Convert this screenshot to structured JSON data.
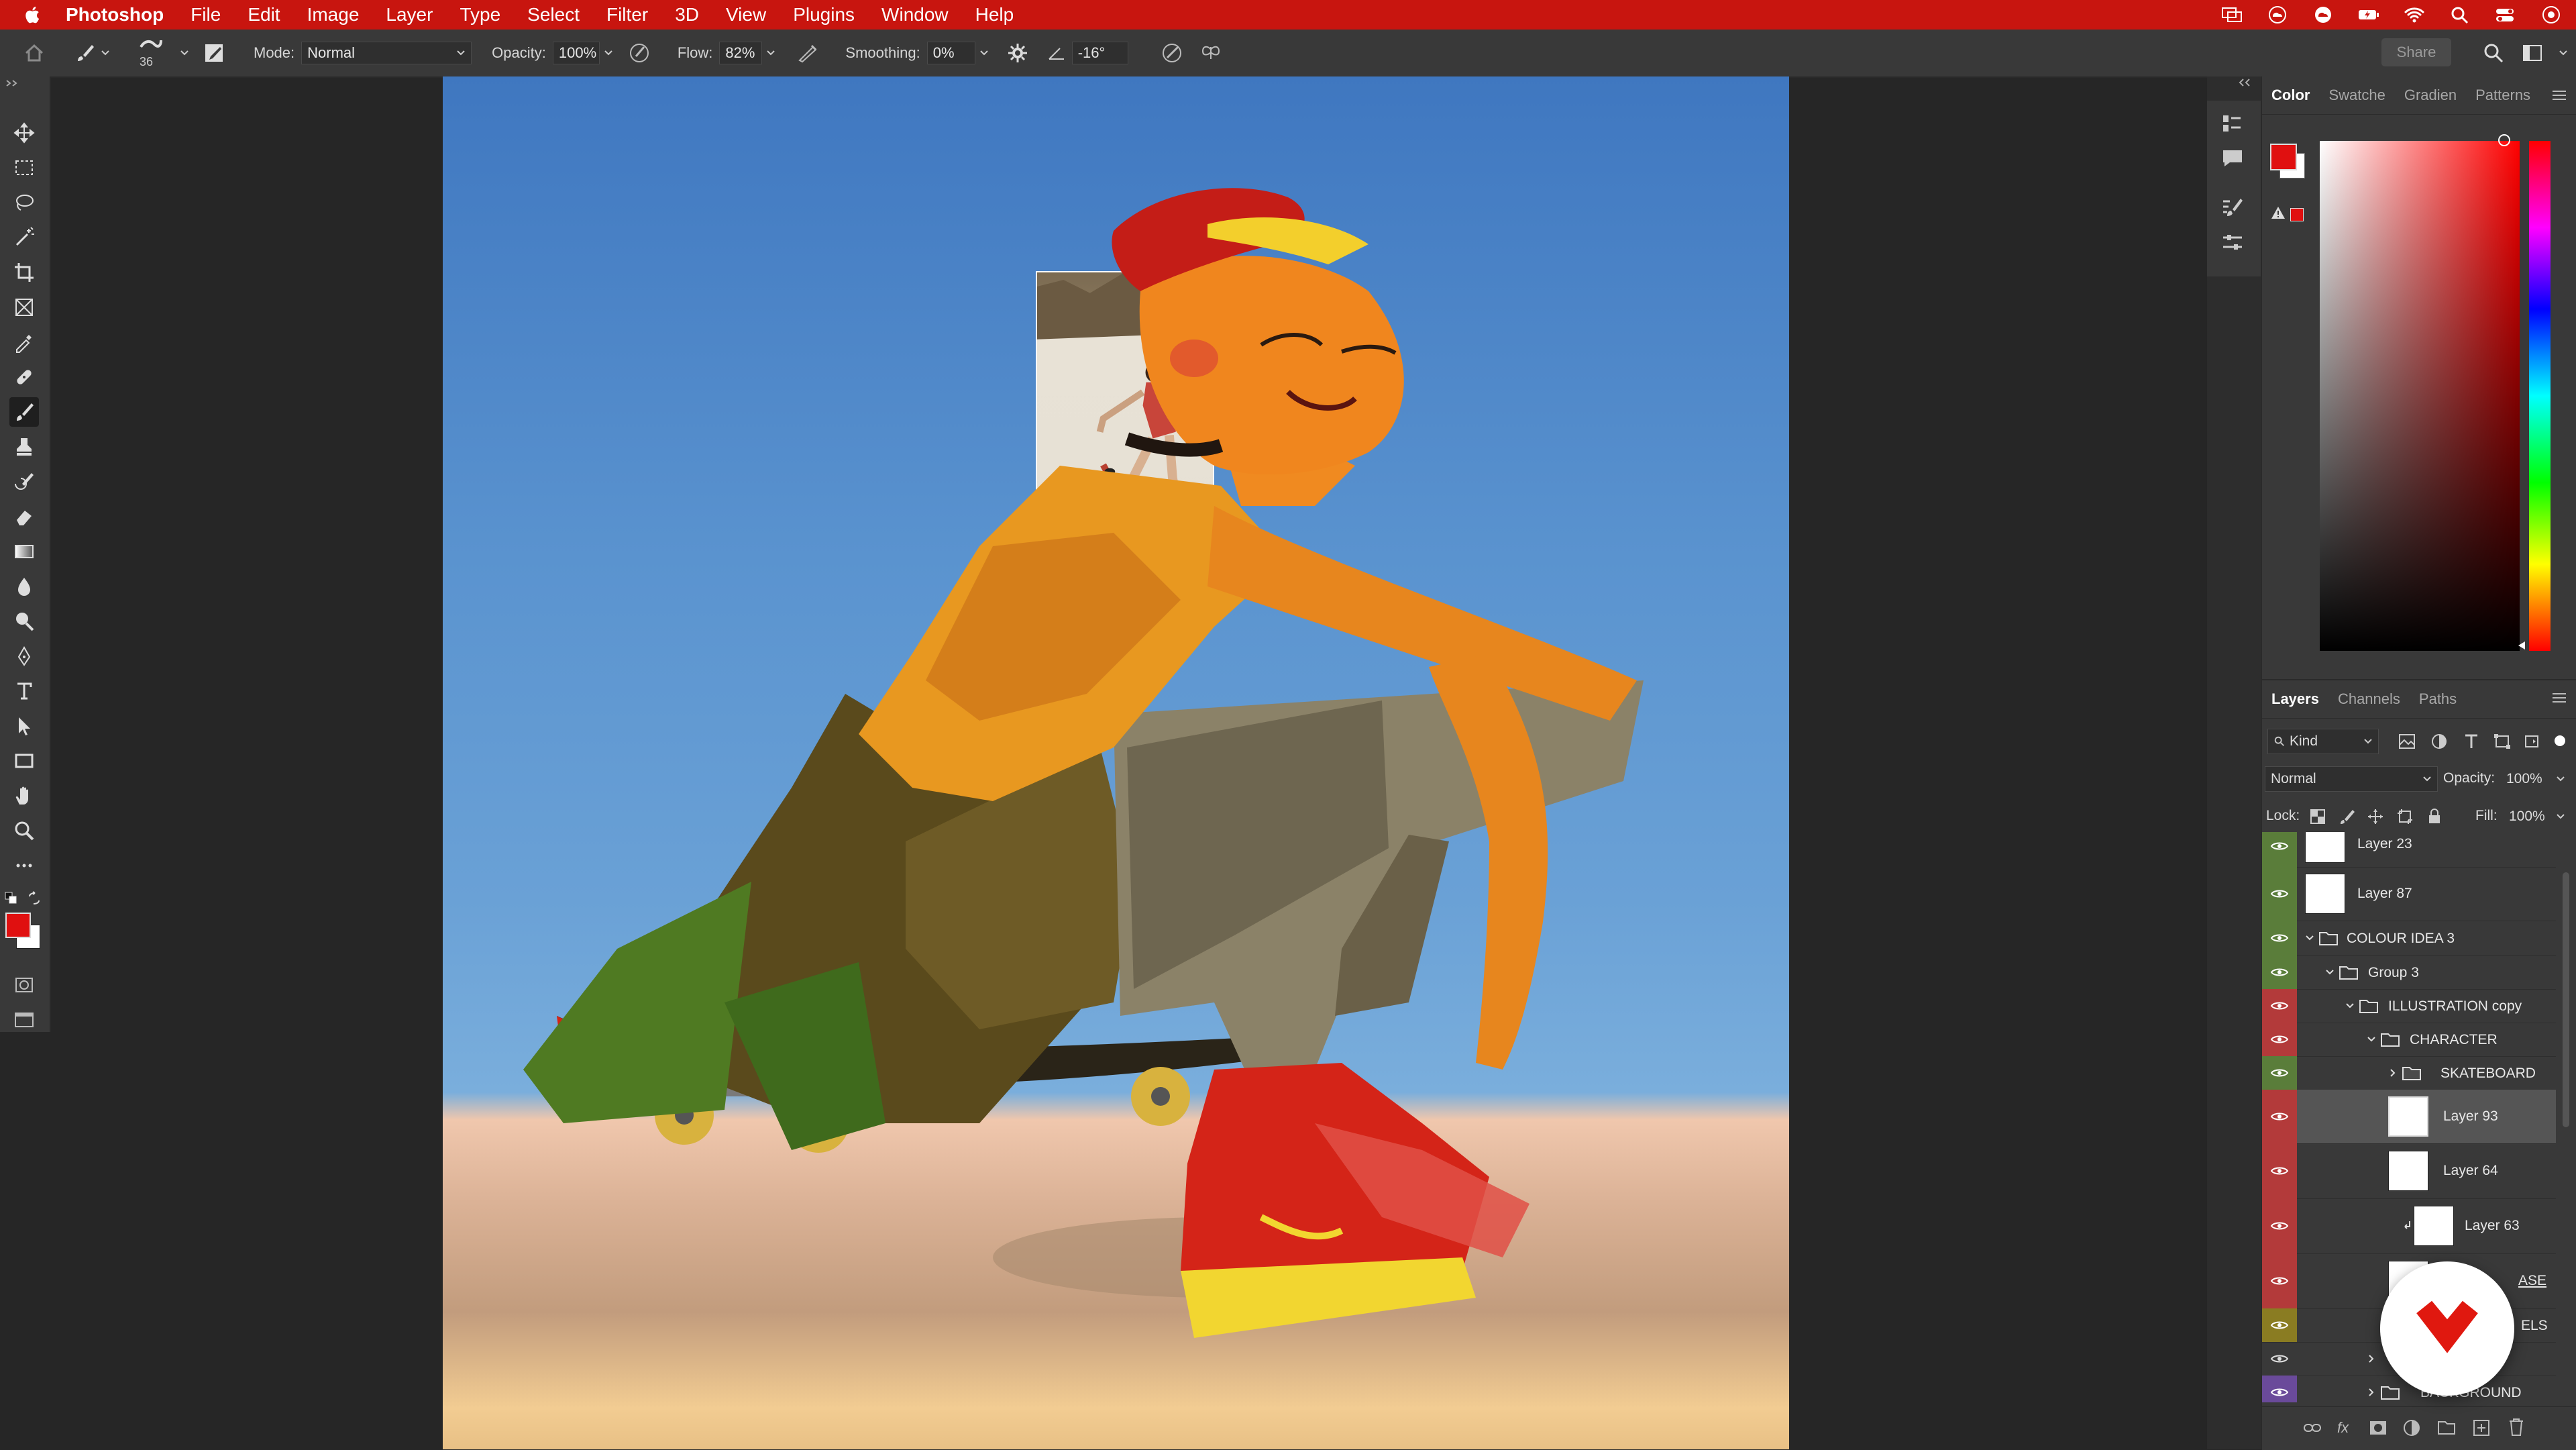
{
  "menubar": {
    "app_name": "Photoshop",
    "menus": [
      "File",
      "Edit",
      "Image",
      "Layer",
      "Type",
      "Select",
      "Filter",
      "3D",
      "View",
      "Plugins",
      "Window",
      "Help"
    ]
  },
  "options_bar": {
    "brush_size": "36",
    "mode_label": "Mode:",
    "mode_value": "Normal",
    "opacity_label": "Opacity:",
    "opacity_value": "100%",
    "flow_label": "Flow:",
    "flow_value": "82%",
    "smoothing_label": "Smoothing:",
    "smoothing_value": "0%",
    "angle_value": "-16°",
    "share_label": "Share"
  },
  "tools": [
    "move-tool",
    "marquee-tool",
    "lasso-tool",
    "magic-wand-tool",
    "crop-tool",
    "frame-tool",
    "eyedropper-tool",
    "healing-brush-tool",
    "brush-tool",
    "clone-stamp-tool",
    "history-brush-tool",
    "eraser-tool",
    "gradient-tool",
    "blur-tool",
    "dodge-tool",
    "pen-tool",
    "type-tool",
    "path-selection-tool",
    "rectangle-tool",
    "hand-tool",
    "zoom-tool",
    "more-tools"
  ],
  "colors": {
    "foreground": "#e01010",
    "background": "#ffffff",
    "menubar": "#c8150f",
    "accent_red": "#b33a3a",
    "accent_green": "#5a7d3a",
    "accent_yellow": "#8a7c22",
    "accent_purple": "#6a4a9a"
  },
  "color_panel": {
    "tabs": [
      "Color",
      "Swatche",
      "Gradien",
      "Patterns"
    ],
    "active_tab": "Color"
  },
  "layers_panel": {
    "tabs": [
      "Layers",
      "Channels",
      "Paths"
    ],
    "active_tab": "Layers",
    "filter_label": "Kind",
    "blend_mode": "Normal",
    "opacity_label": "Opacity:",
    "opacity_value": "100%",
    "lock_label": "Lock:",
    "fill_label": "Fill:",
    "fill_value": "100%",
    "layers": [
      {
        "name": "Layer 23",
        "type": "layer",
        "eye_color": "green"
      },
      {
        "name": "Layer 87",
        "type": "layer",
        "eye_color": "green"
      },
      {
        "name": "COLOUR IDEA 3",
        "type": "group",
        "eye_color": "green"
      },
      {
        "name": "Group 3",
        "type": "group",
        "eye_color": "green"
      },
      {
        "name": "ILLUSTRATION copy",
        "type": "group",
        "eye_color": "red"
      },
      {
        "name": "CHARACTER",
        "type": "group",
        "eye_color": "red"
      },
      {
        "name": "SKATEBOARD",
        "type": "group",
        "eye_color": "green"
      },
      {
        "name": "Layer 93",
        "type": "layer",
        "eye_color": "red",
        "selected": true
      },
      {
        "name": "Layer 64",
        "type": "layer",
        "eye_color": "red"
      },
      {
        "name": "Layer 63",
        "type": "layer",
        "eye_color": "red"
      },
      {
        "name": "ASE",
        "type": "layer",
        "eye_color": "red"
      },
      {
        "name": "ELS",
        "type": "layer",
        "eye_color": "yellow"
      },
      {
        "name": "",
        "type": "group",
        "eye_color": "none"
      },
      {
        "name": "BACKGROUND",
        "type": "group",
        "eye_color": "purple"
      }
    ]
  }
}
